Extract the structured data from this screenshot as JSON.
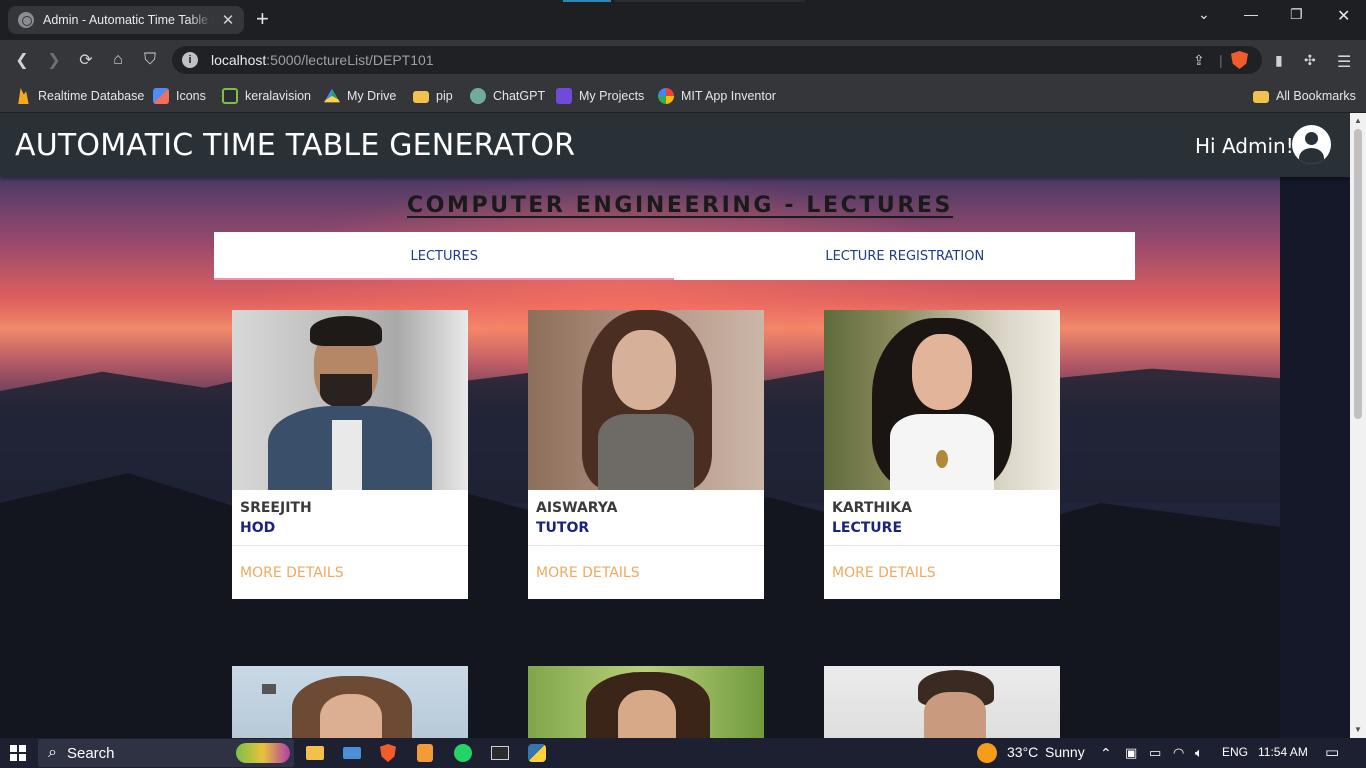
{
  "browser": {
    "tab_title": "Admin - Automatic Time Table G",
    "new_tab": "+",
    "url_host": "localhost",
    "url_path": ":5000/lectureList/DEPT101",
    "bookmarks": [
      {
        "label": "Realtime Database",
        "icon": "firebase-icon",
        "color": "#f6a821"
      },
      {
        "label": "Icons",
        "icon": "icons-app-icon",
        "color": "#4f8df5"
      },
      {
        "label": "keralavision",
        "icon": "keralavision-icon",
        "color": "#7bbf4a"
      },
      {
        "label": "My Drive",
        "icon": "google-drive-icon",
        "color": "#1fa463"
      },
      {
        "label": "pip",
        "icon": "folder-icon",
        "color": "#f2c14e"
      },
      {
        "label": "ChatGPT",
        "icon": "chatgpt-icon",
        "color": "#74aa9c"
      },
      {
        "label": "My Projects",
        "icon": "projects-icon",
        "color": "#6f4bd8"
      },
      {
        "label": "MIT App Inventor",
        "icon": "google-icon",
        "color": "#ea4335"
      }
    ],
    "all_bookmarks": "All Bookmarks"
  },
  "app": {
    "title": "AUTOMATIC TIME TABLE GENERATOR",
    "greeting": "Hi Admin!"
  },
  "page": {
    "section_title": "COMPUTER ENGINEERING - LECTURES",
    "tabs": [
      {
        "label": "LECTURES",
        "active": true
      },
      {
        "label": "LECTURE REGISTRATION",
        "active": false
      }
    ],
    "lecturers": [
      {
        "name": "SREEJITH",
        "role": "HOD",
        "more": "MORE DETAILS"
      },
      {
        "name": "AISWARYA",
        "role": "TUTOR",
        "more": "MORE DETAILS"
      },
      {
        "name": "KARTHIKA",
        "role": "LECTURE",
        "more": "MORE DETAILS"
      }
    ]
  },
  "taskbar": {
    "search_placeholder": "Search",
    "weather_temp": "33°C",
    "weather_text": "Sunny",
    "language": "ENG",
    "time": "11:54 AM"
  },
  "colors": {
    "appbar": "#2a3136",
    "tab_text": "#1f3c88",
    "role_text": "#1a237e",
    "more_link": "#f0a860",
    "tab_indicator": "#f48fb1"
  }
}
